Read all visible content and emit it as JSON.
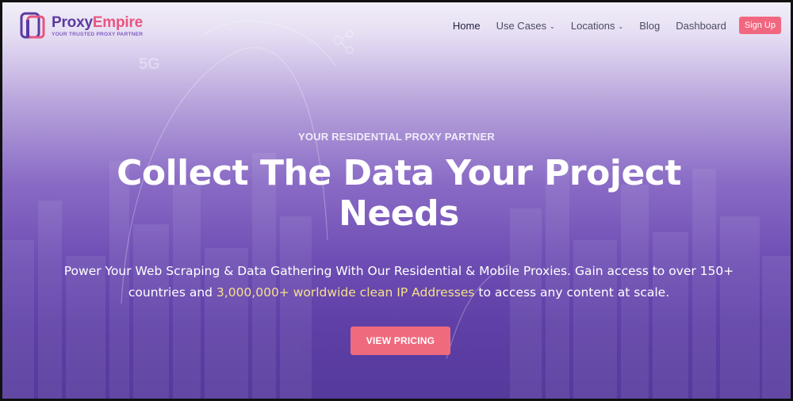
{
  "brand": {
    "name_part1": "Proxy",
    "name_part2": "Empire",
    "tagline": "YOUR TRUSTED PROXY PARTNER",
    "colors": {
      "purple": "#5a3aa0",
      "pink": "#e8557f"
    }
  },
  "nav": {
    "items": [
      {
        "label": "Home",
        "dropdown": false
      },
      {
        "label": "Use Cases",
        "dropdown": true
      },
      {
        "label": "Locations",
        "dropdown": true
      },
      {
        "label": "Blog",
        "dropdown": false
      },
      {
        "label": "Dashboard",
        "dropdown": false
      }
    ],
    "signup_label": "Sign Up"
  },
  "hero": {
    "eyebrow": "YOUR RESIDENTIAL PROXY PARTNER",
    "headline": "Collect The Data Your Project Needs",
    "desc_part1": "Power Your Web Scraping & Data Gathering  With Our Residential & Mobile Proxies. Gain access to over 150+ countries and ",
    "desc_highlight": "3,000,000+ worldwide clean IP Addresses",
    "desc_part2": " to access any content at scale.",
    "cta_label": "VIEW PRICING",
    "background_decor_text": "5G"
  },
  "colors": {
    "accent": "#f06a7e",
    "highlight": "#f6e08a"
  }
}
